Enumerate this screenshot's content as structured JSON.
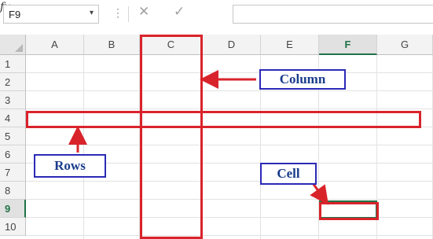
{
  "formula_bar": {
    "name_box": "F9",
    "name_box_arrow": "▾",
    "dots": "⋮",
    "cancel_icon": "✕",
    "enter_icon": "✓",
    "fx_icon": "fx",
    "formula_value": ""
  },
  "sheet": {
    "columns": [
      "A",
      "B",
      "C",
      "D",
      "E",
      "F",
      "G"
    ],
    "rows": [
      "1",
      "2",
      "3",
      "4",
      "5",
      "6",
      "7",
      "8",
      "9",
      "10"
    ],
    "selected_column": "F",
    "selected_row": "9",
    "active_cell": "F9"
  },
  "annotations": {
    "column_label": "Column",
    "rows_label": "Rows",
    "cell_label": "Cell",
    "color": "#d9232b",
    "label_border_color": "#2b2ab8",
    "label_text_color": "#1a3c8c"
  }
}
